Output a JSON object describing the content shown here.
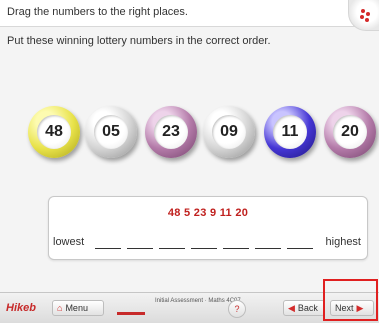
{
  "header": {
    "title": "Drag the numbers to the right places."
  },
  "instruction": "Put these winning lottery numbers in the correct order.",
  "balls": [
    {
      "number": "48",
      "color": "yellow"
    },
    {
      "number": "05",
      "color": "grey"
    },
    {
      "number": "23",
      "color": "purple"
    },
    {
      "number": "09",
      "color": "grey"
    },
    {
      "number": "11",
      "color": "blue"
    },
    {
      "number": "20",
      "color": "purple"
    }
  ],
  "answer": {
    "sequence": "48  5  23  9  11  20",
    "lowest_label": "lowest",
    "highest_label": "highest",
    "blank_count": 7
  },
  "footer": {
    "brand": "Hikeb",
    "menu_label": "Menu",
    "assessment_label": "Initial Assessment · Maths 4C07",
    "back_label": "Back",
    "next_label": "Next"
  },
  "colors": {
    "accent_red": "#c72a2a",
    "highlight": "#e02020"
  },
  "icons": {
    "menu": "house-icon",
    "back": "left-arrow-icon",
    "next": "right-arrow-icon",
    "help": "help-circle-icon"
  }
}
